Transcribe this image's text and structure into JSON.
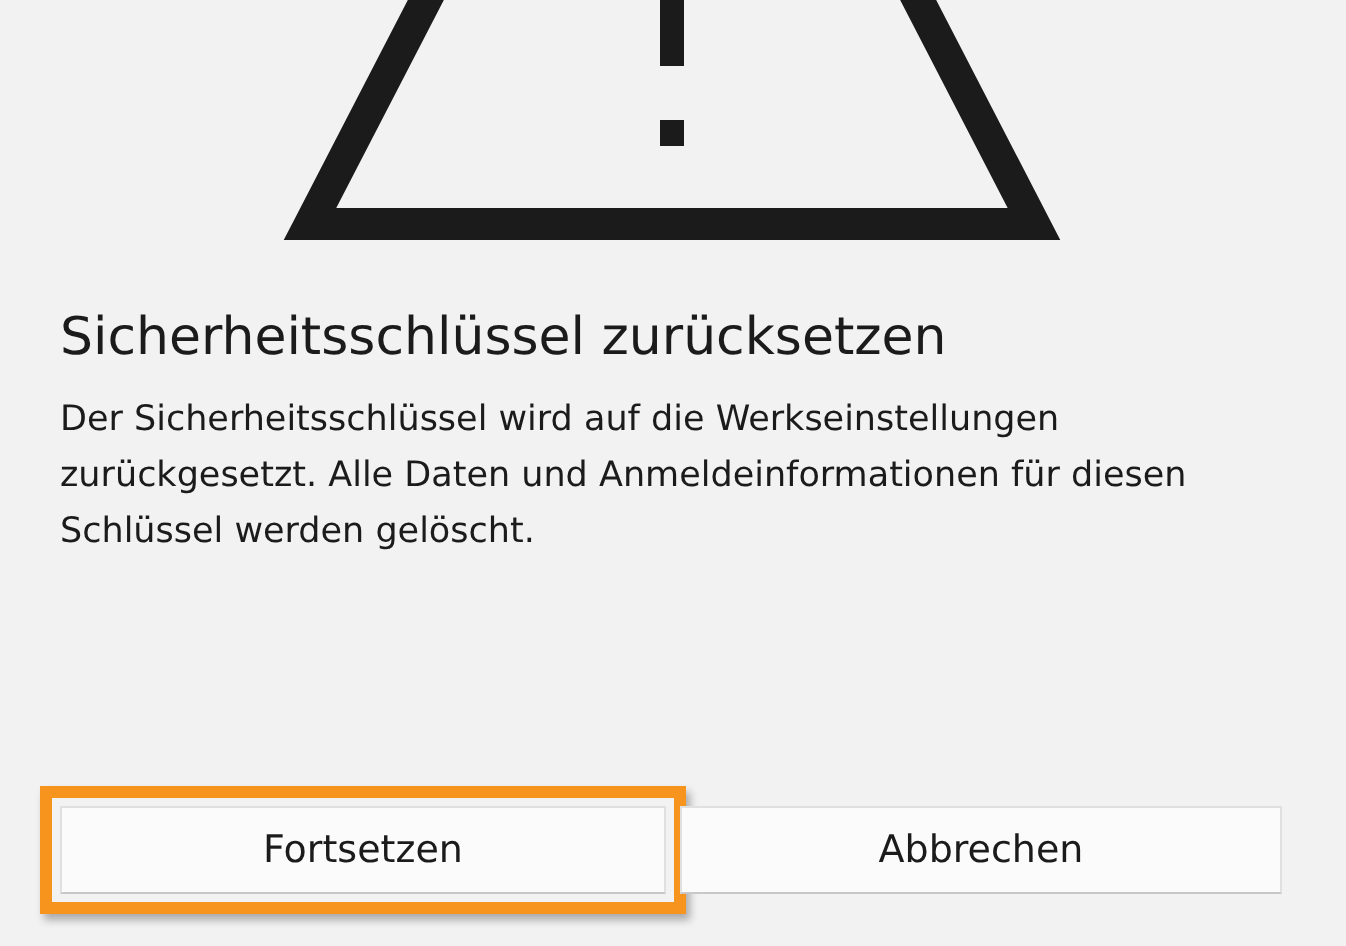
{
  "dialog": {
    "title": "Sicherheitsschlüssel zurücksetzen",
    "message": "Der Sicherheitsschlüssel wird auf die Werkseinstellungen zurückgesetzt. Alle Daten und Anmeldeinformationen für diesen Schlüssel werden gelöscht."
  },
  "buttons": [
    {
      "label": "Fortsetzen",
      "highlighted": true
    },
    {
      "label": "Abbrechen",
      "highlighted": false
    }
  ]
}
